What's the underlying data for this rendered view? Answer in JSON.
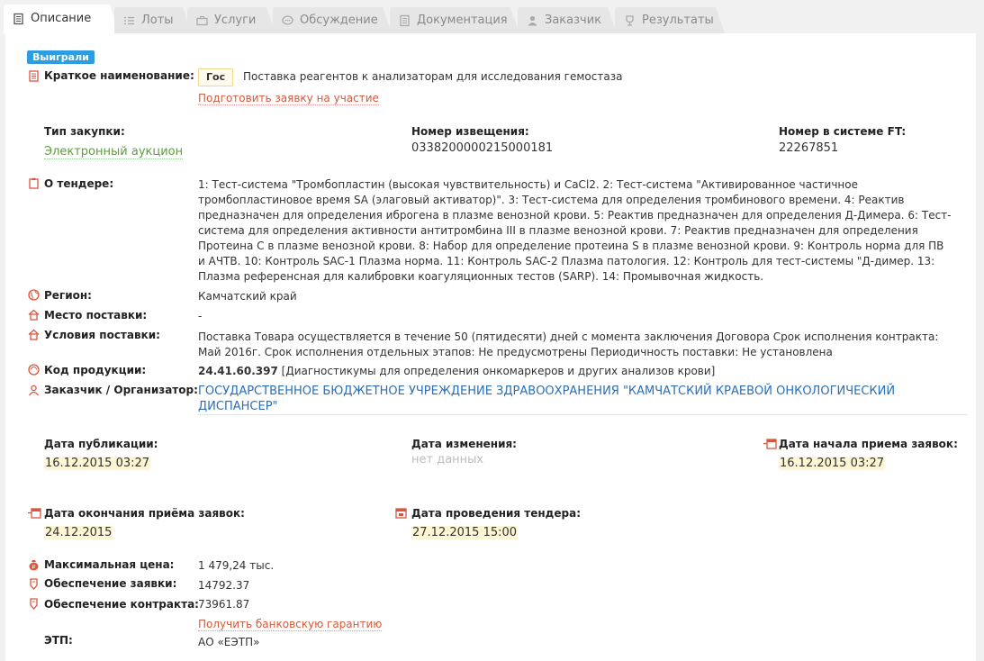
{
  "tabs": [
    {
      "label": "Описание",
      "icon": "document-icon"
    },
    {
      "label": "Лоты",
      "icon": "list-icon"
    },
    {
      "label": "Услуги",
      "icon": "briefcase-icon"
    },
    {
      "label": "Обсуждение",
      "icon": "chat-icon"
    },
    {
      "label": "Документация",
      "icon": "file-icon"
    },
    {
      "label": "Заказчик",
      "icon": "person-icon"
    },
    {
      "label": "Результаты",
      "icon": "trophy-icon"
    }
  ],
  "status_badge": "Выиграли",
  "short_name": {
    "label": "Краткое наименование:",
    "gos_badge": "Гос",
    "value": "Поставка реагентов к анализаторам для исследования гемостаза",
    "action_link": "Подготовить заявку на участие"
  },
  "purchase_type": {
    "label": "Тип закупки:",
    "value": "Электронный аукцион"
  },
  "notice_number": {
    "label": "Номер извещения:",
    "value": "0338200000215000181"
  },
  "ft_number": {
    "label": "Номер в системе FT:",
    "value": "22267851"
  },
  "about": {
    "label": "О тендере:",
    "lines": [
      "1: Тест-система \"Тромбопластин (высокая чувствительность) и CaCl2. 2: Тест-система \"Активированное частичное",
      "тромбопластиновое время SA (элаговый активатор)\". 3: Тест-система для определения тромбинового времени. 4: Реактив",
      "предназначен для определения иброгена в плазме венозной крови. 5: Реактив предназначен для определения Д-Димера. 6: Тест-",
      "система для определения активности антитромбина III в плазме венозной крови. 7: Реактив предназначен для определения",
      "Протеина С в плазме венозной крови. 8: Набор для определение протеина S в плазме венозной крови. 9: Контроль норма для ПВ",
      "и АЧТВ. 10: Контроль SAC-1 Плазма норма. 11: Контроль SAC-2 Плазма патология. 12: Контроль для тест-системы \"Д-димер. 13:",
      "Плазма референсная для калибровки коагуляционных тестов (SARP). 14: Промывочная жидкость."
    ]
  },
  "region": {
    "label": "Регион:",
    "value": "Камчатский край"
  },
  "delivery_place": {
    "label": "Место поставки:",
    "value": "-"
  },
  "delivery_terms": {
    "label": "Условия поставки:",
    "lines": [
      "Поставка Товара осуществляется в течение 50 (пятидесяти) дней с момента заключения Договора Срок исполнения контракта:",
      "Май 2016г. Срок исполнения отдельных этапов: Не предусмотрены Периодичность поставки: Не установлена"
    ]
  },
  "product_code": {
    "label": "Код продукции:",
    "code": "24.41.60.397",
    "description": "[Диагностикумы для определения онкомаркеров и других анализов крови]"
  },
  "customer": {
    "label": "Заказчик / Организатор:",
    "lines": [
      "ГОСУДАРСТВЕННОЕ БЮДЖЕТНОЕ УЧРЕЖДЕНИЕ ЗДРАВООХРАНЕНИЯ \"КАМЧАТСКИЙ КРАЕВОЙ ОНКОЛОГИЧЕСКИЙ",
      "ДИСПАНСЕР\""
    ]
  },
  "dates": {
    "published": {
      "label": "Дата публикации:",
      "value": "16.12.2015 03:27"
    },
    "changed": {
      "label": "Дата изменения:",
      "value": "нет данных"
    },
    "accept_start": {
      "label": "Дата начала приема заявок:",
      "value": "16.12.2015 03:27"
    },
    "accept_end": {
      "label": "Дата окончания приёма заявок:",
      "value": "24.12.2015"
    },
    "tender": {
      "label": "Дата проведения тендера:",
      "value": "27.12.2015 15:00"
    }
  },
  "max_price": {
    "label": "Максимальная цена:",
    "value": "1 479,24 тыс."
  },
  "bid_security": {
    "label": "Обеспечение заявки:",
    "value": "14792.37"
  },
  "contract_security": {
    "label": "Обеспечение контракта:",
    "value": "73961.87",
    "action_link": "Получить банковскую гарантию"
  },
  "etp": {
    "label": "ЭТП:",
    "value": "АО «ЕЭТП»"
  },
  "colors": {
    "accent_blue": "#2d9de0",
    "link_orange": "#d35a3a",
    "link_green": "#5f9b3f",
    "icon_red": "#d9573f"
  }
}
